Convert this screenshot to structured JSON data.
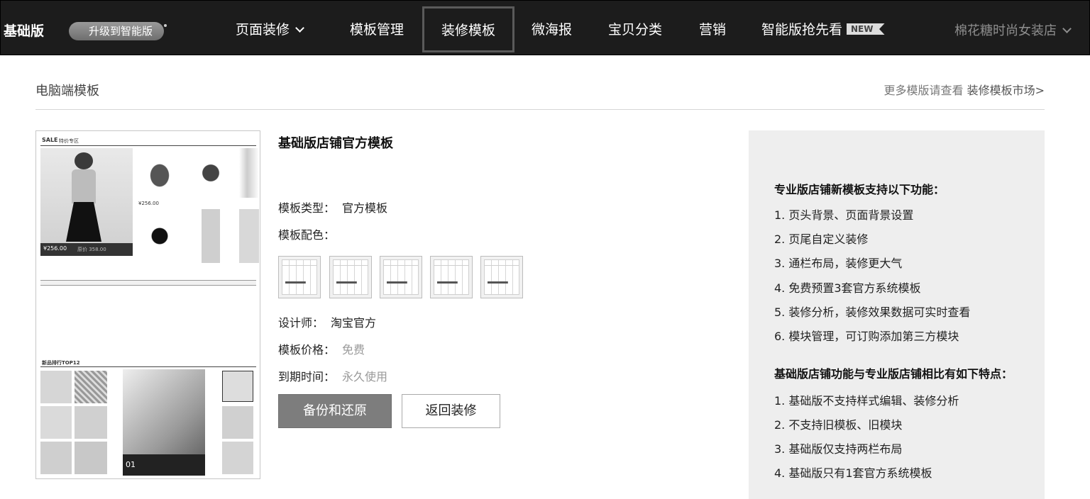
{
  "header": {
    "edition": "基础版",
    "upgrade_label": "升级到智能版",
    "nav": [
      {
        "label": "页面装修",
        "has_dropdown": true
      },
      {
        "label": "模板管理"
      },
      {
        "label": "装修模板",
        "active": true
      },
      {
        "label": "微海报"
      },
      {
        "label": "宝贝分类"
      },
      {
        "label": "营销"
      },
      {
        "label": "智能版抢先看",
        "badge": "NEW"
      }
    ],
    "shop_name": "棉花糖时尚女装店"
  },
  "page": {
    "title": "电脑端模板",
    "more_prefix": "更多模版请查看",
    "more_link": "装修模板市场>"
  },
  "preview": {
    "sale_title": "SALE",
    "sale_sub": "特价专区",
    "featured_price": "¥256.00",
    "featured_old_price": "原价 358.00",
    "small_price": "¥256.00",
    "top_title": "新品排行TOP12",
    "slide_number": "01"
  },
  "template": {
    "name": "基础版店铺官方模板",
    "type_label": "模板类型：",
    "type_value": "官方模板",
    "color_label": "模板配色：",
    "swatch_count": 5,
    "designer_label": "设计师：",
    "designer_value": "淘宝官方",
    "price_label": "模板价格：",
    "price_value": "免费",
    "expiry_label": "到期时间：",
    "expiry_value": "永久使用",
    "backup_button": "备份和还原",
    "back_button": "返回装修"
  },
  "panel": {
    "heading1": "专业版店铺新模板支持以下功能：",
    "list1": [
      "1. 页头背景、页面背景设置",
      "2. 页尾自定义装修",
      "3. 通栏布局，装修更大气",
      "4. 免费预置3套官方系统模板",
      "5. 装修分析，装修效果数据可实时查看",
      "6. 模块管理，可订购添加第三方模块"
    ],
    "heading2": "基础版店铺功能与专业版店铺相比有如下特点：",
    "list2": [
      "1. 基础版不支持样式编辑、装修分析",
      "2. 不支持旧模板、旧模块",
      "3. 基础版仅支持两栏布局",
      "4. 基础版只有1套官方系统模板"
    ]
  },
  "colors": {
    "nav_bg": "#1c1c1c",
    "primary_button": "#7d7d7d",
    "panel_bg": "#eeeeee"
  }
}
